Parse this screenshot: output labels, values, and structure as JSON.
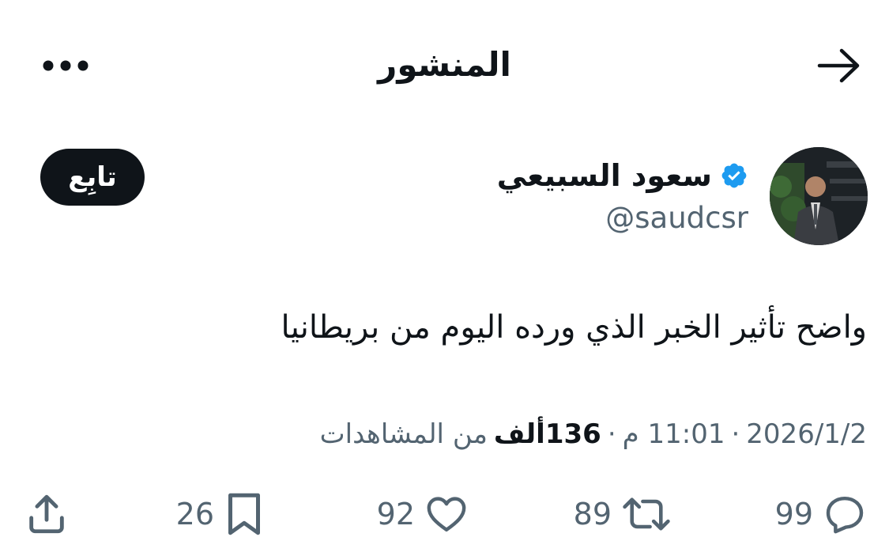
{
  "header": {
    "title": "المنشور",
    "back_icon": "arrow-right-icon",
    "more_icon": "more-dots-icon"
  },
  "author": {
    "name": "سعود السبيعي",
    "handle": "@saudcsr",
    "verified": true,
    "verified_color": "#1d9bf0"
  },
  "follow_button": {
    "label": "تابِع"
  },
  "post": {
    "text": "واضح تأثير الخبر الذي ورده اليوم من بريطانيا",
    "date": "2026/1/2",
    "time": "11:01 م",
    "separator": "·",
    "views_count": "136ألف",
    "views_label": "من المشاهدات"
  },
  "actions": {
    "replies": "99",
    "retweets": "89",
    "likes": "92",
    "bookmarks": "26"
  },
  "colors": {
    "text": "#0f1419",
    "secondary": "#536471",
    "follow_bg": "#0f1419",
    "follow_text": "#ffffff"
  }
}
